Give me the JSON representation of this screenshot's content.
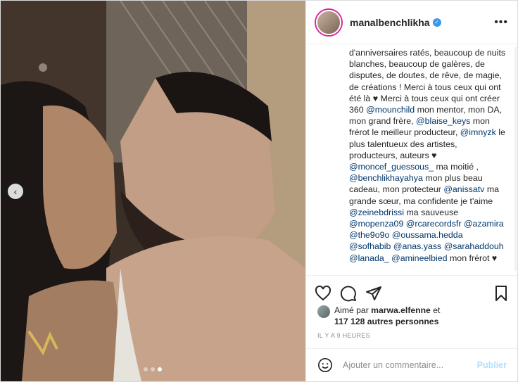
{
  "header": {
    "username": "manalbenchlikha"
  },
  "caption": {
    "segments": [
      {
        "t": "d'anniversaires ratés, beaucoup de nuits blanches, beaucoup de galères, de disputes, de doutes, de rêve, de magie, de créations ! Merci à tous ceux qui ont été là ♥ Merci à tous ceux qui ont créer 360 ",
        "m": false
      },
      {
        "t": "@mounchild",
        "m": true
      },
      {
        "t": " mon mentor, mon DA, mon grand frère, ",
        "m": false
      },
      {
        "t": "@blaise_keys",
        "m": true
      },
      {
        "t": " mon frérot le meilleur producteur, ",
        "m": false
      },
      {
        "t": "@imnyzk",
        "m": true
      },
      {
        "t": " le plus talentueux des artistes, producteurs, auteurs ♥ ",
        "m": false
      },
      {
        "t": "@moncef_guessous_",
        "m": true
      },
      {
        "t": " ma moitié , ",
        "m": false
      },
      {
        "t": "@benchlikhayahya",
        "m": true
      },
      {
        "t": " mon plus beau cadeau, mon protecteur ",
        "m": false
      },
      {
        "t": "@anissatv",
        "m": true
      },
      {
        "t": " ma grande sœur, ma confidente je t'aime ",
        "m": false
      },
      {
        "t": "@zeinebdrissi",
        "m": true
      },
      {
        "t": " ma sauveuse ",
        "m": false
      },
      {
        "t": "@mopenza09",
        "m": true
      },
      {
        "t": " ",
        "m": false
      },
      {
        "t": "@rcarecordsfr",
        "m": true
      },
      {
        "t": " ",
        "m": false
      },
      {
        "t": "@azamira",
        "m": true
      },
      {
        "t": " ",
        "m": false
      },
      {
        "t": "@the9o9o",
        "m": true
      },
      {
        "t": " ",
        "m": false
      },
      {
        "t": "@oussama.hedda",
        "m": true
      },
      {
        "t": " ",
        "m": false
      },
      {
        "t": "@sofhabib",
        "m": true
      },
      {
        "t": " ",
        "m": false
      },
      {
        "t": "@anas.yass",
        "m": true
      },
      {
        "t": " ",
        "m": false
      },
      {
        "t": "@sarahaddouh",
        "m": true
      },
      {
        "t": " ",
        "m": false
      },
      {
        "t": "@lanada_",
        "m": true
      },
      {
        "t": " ",
        "m": false
      },
      {
        "t": "@amineelbied",
        "m": true
      },
      {
        "t": " mon frérot ♥",
        "m": false
      }
    ]
  },
  "likes": {
    "prefix": "Aimé par ",
    "user": "marwa.elfenne",
    "middle": " et ",
    "others": "117 128 autres personnes"
  },
  "time": "IL Y A 9 HEURES",
  "comment": {
    "placeholder": "Ajouter un commentaire...",
    "publish": "Publier"
  },
  "carousel": {
    "slides": 3,
    "active": 3
  },
  "colors": {
    "accent": "#3897f0",
    "mention": "#00376b",
    "publish_disabled": "#b2dffc"
  },
  "icons": [
    "more-options-icon",
    "heart-icon",
    "comment-icon",
    "share-icon",
    "bookmark-icon",
    "smile-icon",
    "verified-icon",
    "carousel-prev-icon"
  ]
}
